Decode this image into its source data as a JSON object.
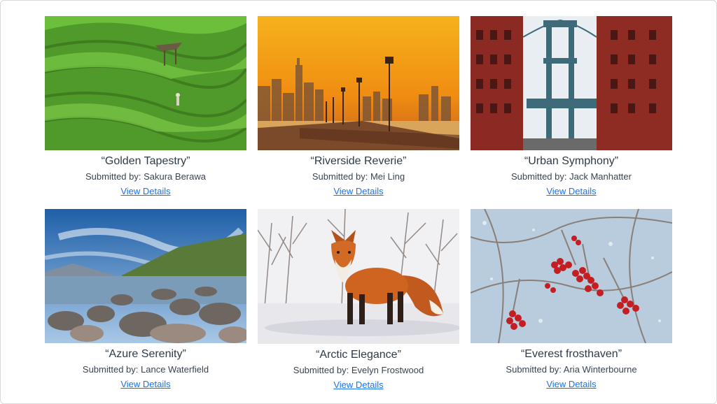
{
  "gallery": {
    "items": [
      {
        "title": "“Golden Tapestry”",
        "submitted": "Submitted by: Sakura Berawa",
        "link": "View Details",
        "image": "rice-terraces-photo"
      },
      {
        "title": "“Riverside Reverie”",
        "submitted": "Submitted by: Mei Ling",
        "link": "View Details",
        "image": "riverside-sunset-photo"
      },
      {
        "title": "“Urban Symphony”",
        "submitted": "Submitted by: Jack Manhatter",
        "link": "View Details",
        "image": "bridge-street-photo"
      },
      {
        "title": "“Azure Serenity”",
        "submitted": "Submitted by: Lance Waterfield",
        "link": "View Details",
        "image": "rocky-coast-photo"
      },
      {
        "title": "“Arctic Elegance”",
        "submitted": "Submitted by: Evelyn Frostwood",
        "link": "View Details",
        "image": "red-fox-snow-photo"
      },
      {
        "title": "“Everest frosthaven”",
        "submitted": "Submitted by: Aria Winterbourne",
        "link": "View Details",
        "image": "frosted-berries-photo"
      }
    ]
  },
  "colors": {
    "link": "#1a73e8",
    "title_text": "#2f3a45"
  }
}
